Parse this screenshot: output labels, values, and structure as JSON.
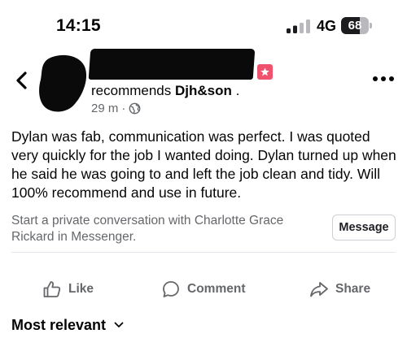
{
  "status_bar": {
    "time": "14:15",
    "network": "4G",
    "battery_level": "68",
    "battery_fraction": 0.68,
    "signal_icon": "signal-bars-icon",
    "battery_icon": "battery-icon"
  },
  "header": {
    "back_icon": "chevron-left-icon",
    "more_icon": "ellipsis-icon",
    "badge_icon": "star-badge-icon",
    "badge_color": "#f0526e"
  },
  "post": {
    "recommends_prefix": "recommends ",
    "page_name": "Djh&son",
    "page_name_suffix": " .",
    "time_ago": "29 m",
    "separator": "·",
    "privacy_icon": "globe-icon",
    "body": "Dylan was fab, communication was perfect. I was quoted very quickly for the job I wanted doing. Dylan turned up when he said he was going to and left the job clean and tidy. Will 100% recommend and use in future."
  },
  "messenger_prompt": {
    "text": "Start a private conversation with Charlotte Grace Rickard in Messenger.",
    "button_label": "Message"
  },
  "actions": {
    "like_label": "Like",
    "comment_label": "Comment",
    "share_label": "Share",
    "like_icon": "thumbs-up-icon",
    "comment_icon": "speech-bubble-icon",
    "share_icon": "share-arrow-icon"
  },
  "comments": {
    "sort_label": "Most relevant",
    "sort_icon": "chevron-down-icon"
  },
  "colors": {
    "text_primary": "#050505",
    "text_secondary": "#65676b",
    "divider": "#e4e6eb"
  }
}
